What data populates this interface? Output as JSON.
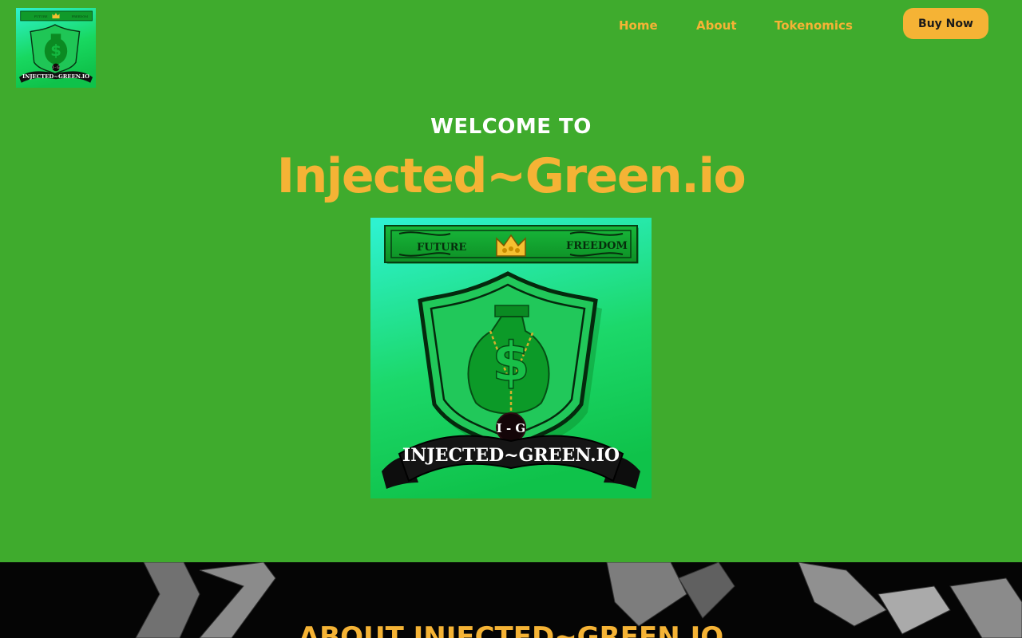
{
  "header": {
    "logo": {
      "banner_left": "FUTURE",
      "banner_right": "FREEDOM",
      "emblem": "I - G",
      "ribbon": "INJECTED~GREEN.IO"
    },
    "nav": [
      {
        "label": "Home"
      },
      {
        "label": "About"
      },
      {
        "label": "Tokenomics"
      }
    ],
    "buy_label": "Buy Now"
  },
  "hero": {
    "welcome": "WELCOME TO",
    "title": "Injected~Green.io",
    "logo": {
      "banner_left": "FUTURE",
      "banner_right": "FREEDOM",
      "emblem": "I - G",
      "ribbon": "INJECTED~GREEN.IO"
    }
  },
  "about": {
    "title": "ABOUT INJECTED~GREEN.IO"
  },
  "colors": {
    "page_bg": "#3fab2d",
    "accent": "#f5b335",
    "dark_band": "#050505",
    "logo_gradient_top": "#2ef2d0",
    "logo_gradient_bottom": "#0fc24a"
  }
}
